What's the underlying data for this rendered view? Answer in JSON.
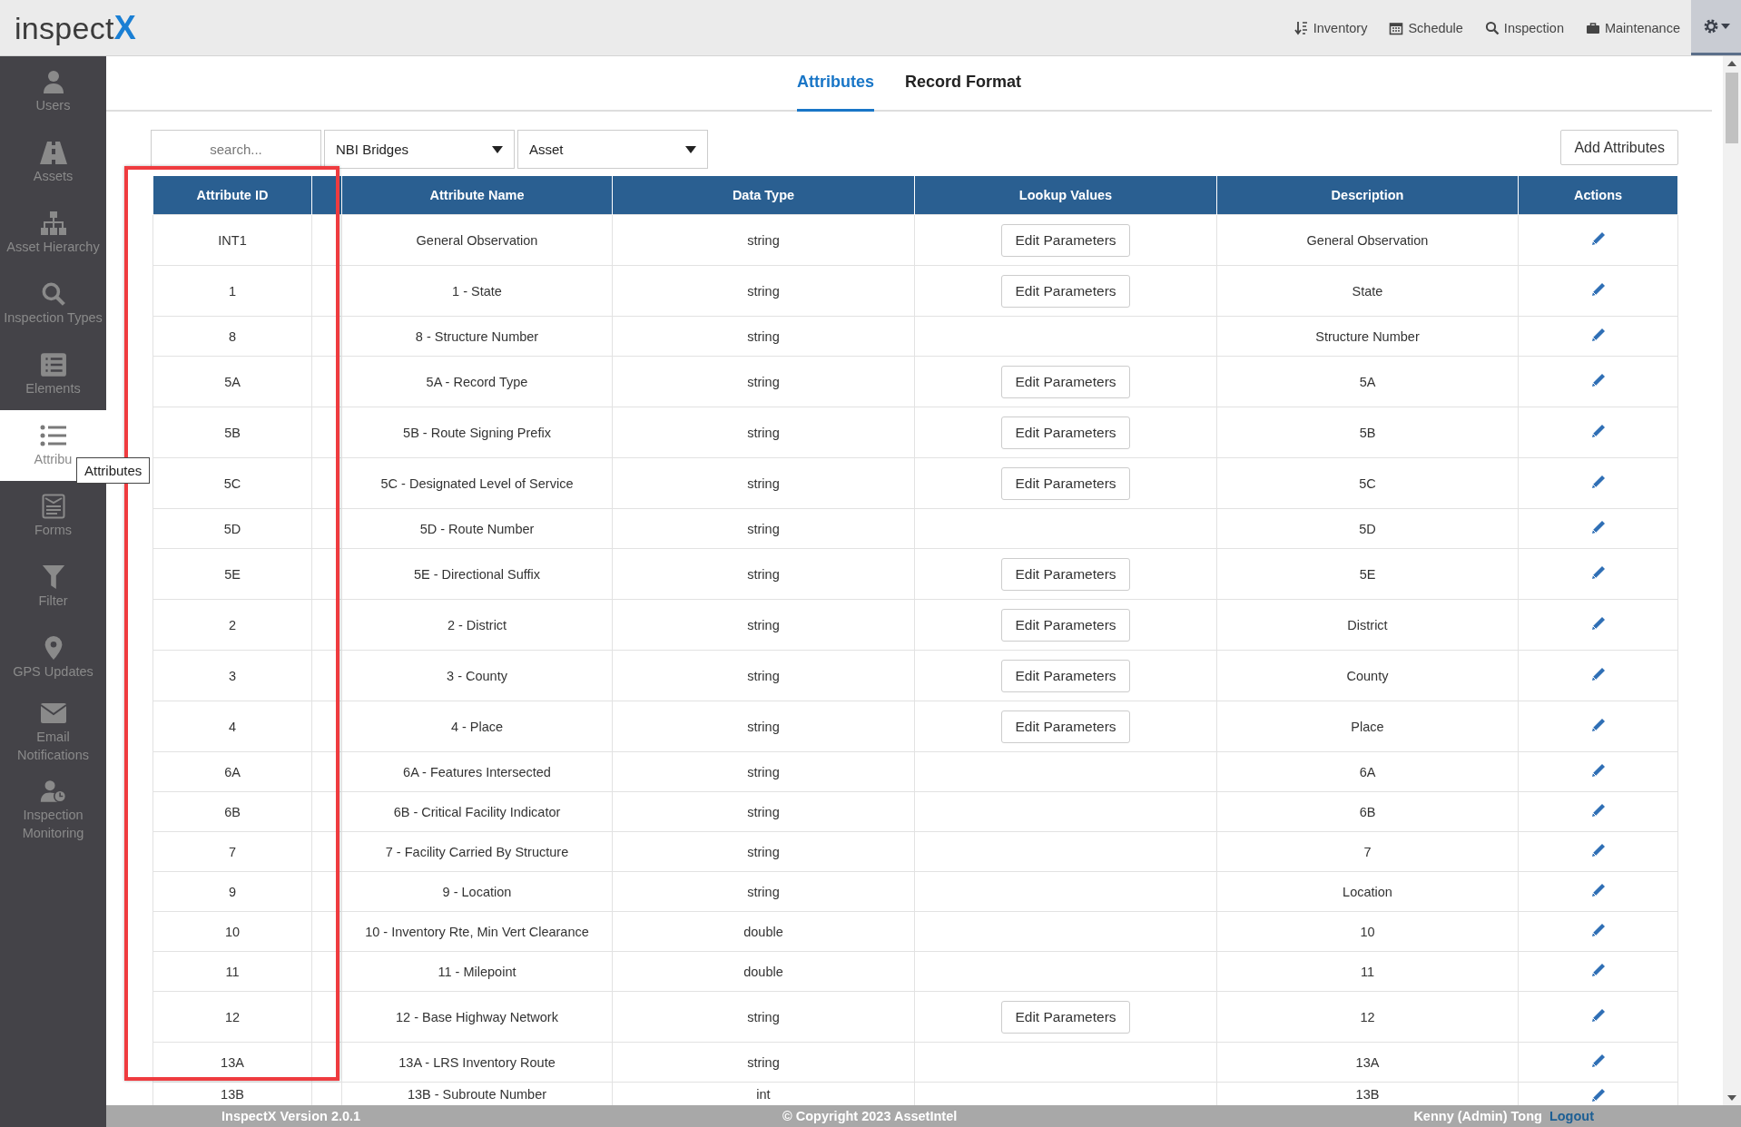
{
  "top_bar": {
    "logo": {
      "text": "inspect",
      "accent": "X"
    },
    "nav": [
      {
        "label": "Inventory"
      },
      {
        "label": "Schedule"
      },
      {
        "label": "Inspection"
      },
      {
        "label": "Maintenance"
      }
    ]
  },
  "sidebar": {
    "items": [
      {
        "label": "Users",
        "selected": false
      },
      {
        "label": "Assets",
        "selected": false
      },
      {
        "label": "Asset Hierarchy",
        "selected": false
      },
      {
        "label": "Inspection Types",
        "selected": false
      },
      {
        "label": "Elements",
        "selected": false
      },
      {
        "label": "Attribu",
        "selected": true
      },
      {
        "label": "Forms",
        "selected": false
      },
      {
        "label": "Filter",
        "selected": false
      },
      {
        "label": "GPS Updates",
        "selected": false
      },
      {
        "label": "Email Notifications",
        "selected": false
      },
      {
        "label": "Inspection Monitoring",
        "selected": false
      }
    ],
    "tooltip": "Attributes"
  },
  "tabs": [
    {
      "label": "Attributes",
      "selected": true
    },
    {
      "label": "Record Format",
      "selected": false
    }
  ],
  "filters": {
    "search": {
      "placeholder": "search..."
    },
    "dropdowns": [
      "NBI Bridges",
      "Asset"
    ],
    "add_button": "Add Attributes"
  },
  "table": {
    "columns": [
      "Attribute ID",
      "",
      "Attribute Name",
      "Data Type",
      "Lookup Values",
      "Description",
      "Actions"
    ],
    "rows": [
      {
        "id": "INT1",
        "name": "General Observation",
        "type": "string",
        "lookup": "Edit Parameters",
        "description": "General Observation"
      },
      {
        "id": "1",
        "name": "1 - State",
        "type": "string",
        "lookup": "Edit Parameters",
        "description": "State"
      },
      {
        "id": "8",
        "name": "8 - Structure Number",
        "type": "string",
        "description": "Structure Number"
      },
      {
        "id": "5A",
        "name": "5A - Record Type",
        "type": "string",
        "lookup": "Edit Parameters",
        "description": "5A"
      },
      {
        "id": "5B",
        "name": "5B - Route Signing Prefix",
        "type": "string",
        "lookup": "Edit Parameters",
        "description": "5B"
      },
      {
        "id": "5C",
        "name": "5C - Designated Level of Service",
        "type": "string",
        "lookup": "Edit Parameters",
        "description": "5C"
      },
      {
        "id": "5D",
        "name": "5D - Route Number",
        "type": "string",
        "description": "5D"
      },
      {
        "id": "5E",
        "name": "5E - Directional Suffix",
        "type": "string",
        "lookup": "Edit Parameters",
        "description": "5E"
      },
      {
        "id": "2",
        "name": "2 - District",
        "type": "string",
        "lookup": "Edit Parameters",
        "description": "District"
      },
      {
        "id": "3",
        "name": "3 - County",
        "type": "string",
        "lookup": "Edit Parameters",
        "description": "County"
      },
      {
        "id": "4",
        "name": "4 - Place",
        "type": "string",
        "lookup": "Edit Parameters",
        "description": "Place"
      },
      {
        "id": "6A",
        "name": "6A - Features Intersected",
        "type": "string",
        "description": "6A"
      },
      {
        "id": "6B",
        "name": "6B - Critical Facility Indicator",
        "type": "string",
        "description": "6B"
      },
      {
        "id": "7",
        "name": "7 - Facility Carried By Structure",
        "type": "string",
        "description": "7"
      },
      {
        "id": "9",
        "name": "9 - Location",
        "type": "string",
        "description": "Location"
      },
      {
        "id": "10",
        "name": "10 - Inventory Rte, Min Vert Clearance",
        "type": "double",
        "description": "10"
      },
      {
        "id": "11",
        "name": "11 - Milepoint",
        "type": "double",
        "description": "11"
      },
      {
        "id": "12",
        "name": "12 - Base Highway Network",
        "type": "string",
        "lookup": "Edit Parameters",
        "description": "12"
      },
      {
        "id": "13A",
        "name": "13A - LRS Inventory Route",
        "type": "string",
        "description": "13A"
      },
      {
        "id": "13B",
        "name": "13B - Subroute Number",
        "type": "int",
        "description": "13B"
      }
    ]
  },
  "footer": {
    "version": "InspectX Version 2.0.1",
    "copyright": "© Copyright 2023 AssetIntel",
    "user": "Kenny (Admin) Tong",
    "logout": "Logout"
  }
}
